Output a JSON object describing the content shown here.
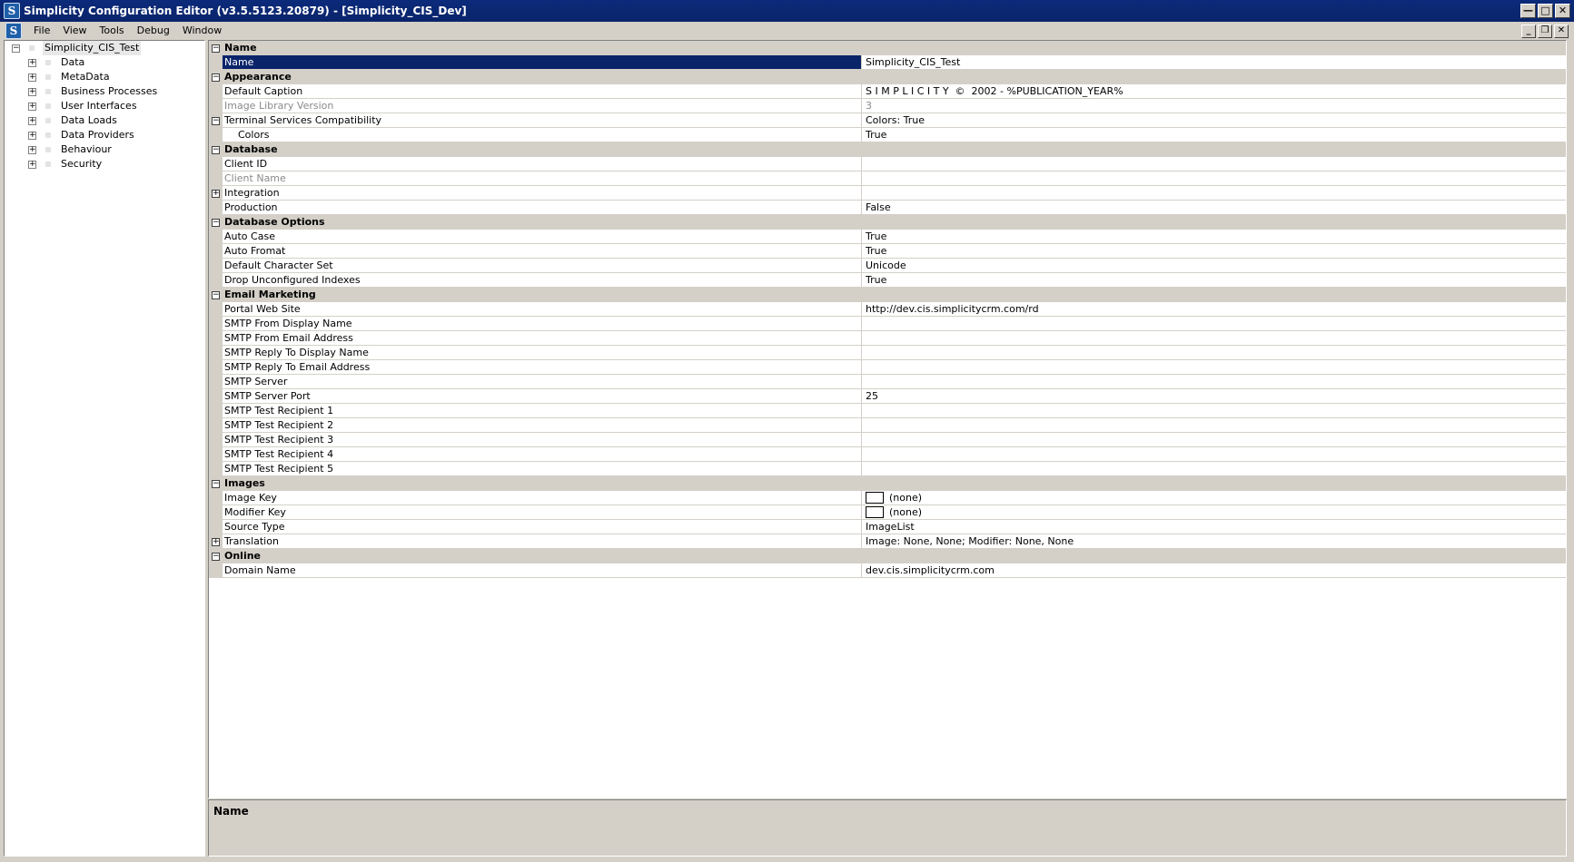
{
  "window": {
    "title": "Simplicity Configuration Editor (v3.5.5123.20879) - [Simplicity_CIS_Dev]",
    "app_icon_letter": "S"
  },
  "menu": [
    "File",
    "View",
    "Tools",
    "Debug",
    "Window"
  ],
  "tree": {
    "root": "Simplicity_CIS_Test",
    "items": [
      "Data",
      "MetaData",
      "Business Processes",
      "User Interfaces",
      "Data Loads",
      "Data Providers",
      "Behaviour",
      "Security"
    ]
  },
  "grid": {
    "rows": [
      {
        "kind": "category",
        "label": "Name",
        "state": "collapse"
      },
      {
        "kind": "prop",
        "name": "Name",
        "value": "Simplicity_CIS_Test",
        "selected": true
      },
      {
        "kind": "category",
        "label": "Appearance",
        "state": "collapse"
      },
      {
        "kind": "prop",
        "name": "Default Caption",
        "value": "S I M P L I C I T Y  ©  2002 - %PUBLICATION_YEAR%"
      },
      {
        "kind": "prop",
        "name": "Image Library Version",
        "value": "3",
        "dim": true
      },
      {
        "kind": "prop",
        "name": "Terminal Services Compatibility",
        "value": "Colors: True",
        "expander": "collapse"
      },
      {
        "kind": "prop",
        "name": "Colors",
        "value": "True",
        "sub": true
      },
      {
        "kind": "category",
        "label": "Database",
        "state": "collapse"
      },
      {
        "kind": "prop",
        "name": "Client ID",
        "value": ""
      },
      {
        "kind": "prop",
        "name": "Client Name",
        "value": "",
        "dim": true
      },
      {
        "kind": "prop",
        "name": "Integration",
        "value": "",
        "expander": "expand"
      },
      {
        "kind": "prop",
        "name": "Production",
        "value": "False"
      },
      {
        "kind": "category",
        "label": "Database Options",
        "state": "collapse"
      },
      {
        "kind": "prop",
        "name": "Auto Case",
        "value": "True"
      },
      {
        "kind": "prop",
        "name": "Auto Fromat",
        "value": "True"
      },
      {
        "kind": "prop",
        "name": "Default Character Set",
        "value": "Unicode"
      },
      {
        "kind": "prop",
        "name": "Drop Unconfigured Indexes",
        "value": "True"
      },
      {
        "kind": "category",
        "label": "Email Marketing",
        "state": "collapse"
      },
      {
        "kind": "prop",
        "name": "Portal Web Site",
        "value": "http://dev.cis.simplicitycrm.com/rd"
      },
      {
        "kind": "prop",
        "name": "SMTP From Display Name",
        "value": ""
      },
      {
        "kind": "prop",
        "name": "SMTP From Email Address",
        "value": ""
      },
      {
        "kind": "prop",
        "name": "SMTP Reply To Display Name",
        "value": ""
      },
      {
        "kind": "prop",
        "name": "SMTP Reply To Email Address",
        "value": ""
      },
      {
        "kind": "prop",
        "name": "SMTP Server",
        "value": ""
      },
      {
        "kind": "prop",
        "name": "SMTP Server Port",
        "value": "25"
      },
      {
        "kind": "prop",
        "name": "SMTP Test Recipient 1",
        "value": ""
      },
      {
        "kind": "prop",
        "name": "SMTP Test Recipient 2",
        "value": ""
      },
      {
        "kind": "prop",
        "name": "SMTP Test Recipient 3",
        "value": ""
      },
      {
        "kind": "prop",
        "name": "SMTP Test Recipient 4",
        "value": ""
      },
      {
        "kind": "prop",
        "name": "SMTP Test Recipient 5",
        "value": ""
      },
      {
        "kind": "category",
        "label": "Images",
        "state": "collapse"
      },
      {
        "kind": "prop",
        "name": "Image Key",
        "value": "(none)",
        "swatch": true
      },
      {
        "kind": "prop",
        "name": "Modifier Key",
        "value": "(none)",
        "swatch": true
      },
      {
        "kind": "prop",
        "name": "Source Type",
        "value": "ImageList"
      },
      {
        "kind": "prop",
        "name": "Translation",
        "value": "Image: None, None; Modifier: None, None",
        "expander": "expand"
      },
      {
        "kind": "category",
        "label": "Online",
        "state": "collapse"
      },
      {
        "kind": "prop",
        "name": "Domain Name",
        "value": "dev.cis.simplicitycrm.com"
      }
    ]
  },
  "description": {
    "title": "Name"
  }
}
